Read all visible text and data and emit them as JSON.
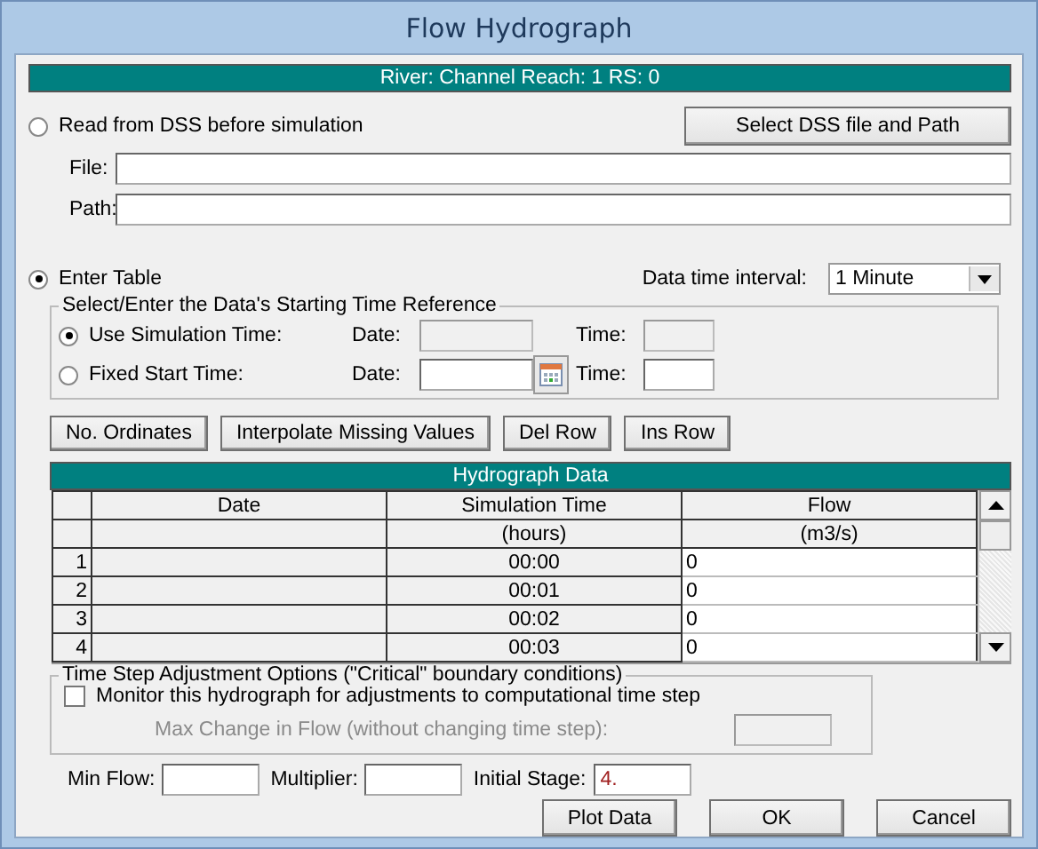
{
  "window": {
    "title": "Flow Hydrograph"
  },
  "location_bar": "River: Channel  Reach: 1  RS: 0",
  "dss": {
    "option": {
      "label": "Read from DSS before simulation",
      "selected": false
    },
    "button": "Select DSS file and Path",
    "fields": [
      {
        "label": "File:"
      },
      {
        "label": "Path:"
      }
    ]
  },
  "table_option": {
    "label": "Enter Table",
    "selected": true
  },
  "interval": {
    "label": "Data time interval:",
    "value": "1 Minute"
  },
  "time_reference": {
    "title": "Select/Enter the Data's Starting Time Reference",
    "options": [
      {
        "label": "Use Simulation Time:",
        "selected": true,
        "date_label": "Date:",
        "time_label": "Time:",
        "fields_disabled": true,
        "calendar": false
      },
      {
        "label": "Fixed Start Time:",
        "selected": false,
        "date_label": "Date:",
        "time_label": "Time:",
        "fields_disabled": false,
        "calendar": true
      }
    ]
  },
  "table_buttons": [
    "No. Ordinates",
    "Interpolate Missing Values",
    "Del Row",
    "Ins Row"
  ],
  "table": {
    "title": "Hydrograph Data",
    "columns": [
      {
        "label": "Date"
      },
      {
        "label": "Simulation Time",
        "unit": "(hours)"
      },
      {
        "label": "Flow",
        "unit": "(m3/s)"
      }
    ],
    "rows": [
      {
        "number": "1",
        "time": "00:00",
        "flow": "0"
      },
      {
        "number": "2",
        "time": "00:01",
        "flow": "0"
      },
      {
        "number": "3",
        "time": "00:02",
        "flow": "0"
      },
      {
        "number": "4",
        "time": "00:03",
        "flow": "0"
      }
    ]
  },
  "time_step": {
    "title": "Time Step Adjustment Options (\"Critical\" boundary conditions)",
    "monitor": {
      "label": "Monitor this hydrograph for adjustments to computational time step",
      "checked": false
    },
    "max_change": {
      "label": "Max Change in Flow (without changing time step):",
      "disabled": true
    }
  },
  "bottom_fields": [
    {
      "label": "Min Flow:"
    },
    {
      "label": "Multiplier:"
    },
    {
      "label": "Initial Stage:",
      "value": "4."
    }
  ],
  "buttons": [
    "Plot Data",
    "OK",
    "Cancel"
  ]
}
